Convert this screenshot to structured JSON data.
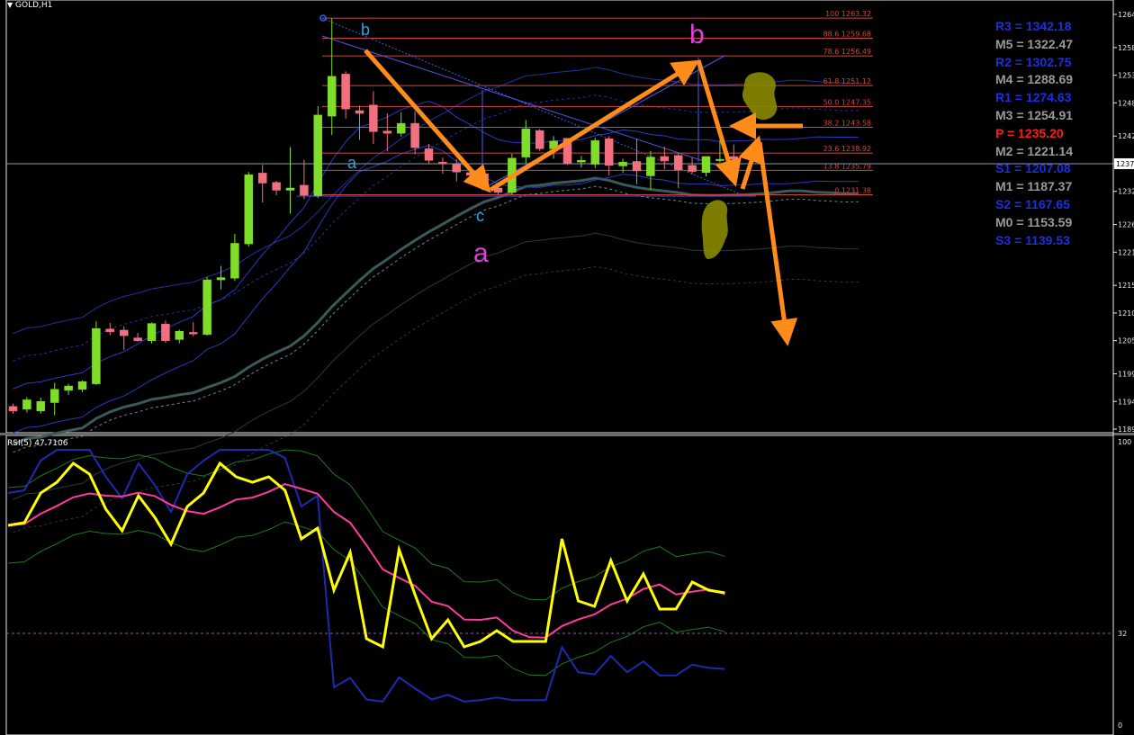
{
  "window": {
    "symbol_label": "GOLD,H1",
    "dropdown_icon": "triangle-down-icon"
  },
  "price_axis_ticks": [
    "1264",
    "1258",
    "1253",
    "1248",
    "1242",
    "1237",
    "1232",
    "1226",
    "1221",
    "1215",
    "1210",
    "1205",
    "1199",
    "1194",
    "1189"
  ],
  "current_price_tag": "1237",
  "fibonacci": {
    "levels": [
      {
        "label": "100 1263.32",
        "price": 1263.32
      },
      {
        "label": "88.6 1259.68",
        "price": 1259.68
      },
      {
        "label": "78.6 1256.49",
        "price": 1256.49
      },
      {
        "label": "61.8 1251.12",
        "price": 1251.12
      },
      {
        "label": "50.0 1247.35",
        "price": 1247.35
      },
      {
        "label": "38.2 1243.58",
        "price": 1243.58
      },
      {
        "label": "23.6 1238.92",
        "price": 1238.92
      },
      {
        "label": "13.8 1235.79",
        "price": 1235.79
      },
      {
        "label": "0 1231.38",
        "price": 1231.38
      }
    ],
    "color": "#d0463c"
  },
  "wave_labels": {
    "b_small": "b",
    "a_small": "a",
    "c_small": "c",
    "a_big": "a",
    "b_big": "b",
    "small_color": "#2aa8e6",
    "big_color": "#e040d8"
  },
  "pivots": [
    {
      "label": "R3",
      "value": "1342.18",
      "text": "R3 = 1342.18",
      "color": "#1a2fe0"
    },
    {
      "label": "M5",
      "value": "1322.47",
      "text": "M5 = 1322.47",
      "color": "#9a9a9a"
    },
    {
      "label": "R2",
      "value": "1302.75",
      "text": "R2 = 1302.75",
      "color": "#1a2fe0"
    },
    {
      "label": "M4",
      "value": "1288.69",
      "text": "M4 = 1288.69",
      "color": "#9a9a9a"
    },
    {
      "label": "R1",
      "value": "1274.63",
      "text": "R1 = 1274.63",
      "color": "#1a2fe0"
    },
    {
      "label": "M3",
      "value": "1254.91",
      "text": "M3 = 1254.91",
      "color": "#9a9a9a"
    },
    {
      "label": "P",
      "value": "1235.20",
      "text": "P  = 1235.20",
      "color": "#ff1a1a"
    },
    {
      "label": "M2",
      "value": "1221.14",
      "text": "M2 = 1221.14",
      "color": "#9a9a9a"
    },
    {
      "label": "S1",
      "value": "1207.08",
      "text": "S1 = 1207.08",
      "color": "#1a2fe0"
    },
    {
      "label": "M1",
      "value": "1187.37",
      "text": "M1 = 1187.37",
      "color": "#9a9a9a"
    },
    {
      "label": "S2",
      "value": "1167.65",
      "text": "S2 = 1167.65",
      "color": "#1a2fe0"
    },
    {
      "label": "M0",
      "value": "1153.59",
      "text": "M0 = 1153.59",
      "color": "#9a9a9a"
    },
    {
      "label": "S3",
      "value": "1139.53",
      "text": "S3 = 1139.53",
      "color": "#1a2fe0"
    }
  ],
  "rsi_panel": {
    "title": "RSI(5) 47.7106",
    "axis_ticks": [
      "100",
      "32",
      "0"
    ],
    "level_value": 32
  },
  "colors": {
    "bull_candle": "#7fdc2a",
    "bear_candle": "#f07080",
    "arrow": "#ff8c1a",
    "rsi_line": "#ffff00",
    "rsi_ma": "#ff3aa0",
    "stoch_line": "#1e2ab0",
    "band_line": "#1e7a1e",
    "highlight_blob": "#8a8a00"
  },
  "chart_data": [
    {
      "type": "candlestick",
      "title": "GOLD,H1",
      "y_axis_ticks": [
        1264,
        1258,
        1253,
        1248,
        1242,
        1237,
        1232,
        1226,
        1221,
        1215,
        1210,
        1205,
        1199,
        1194,
        1189
      ],
      "ylim": [
        1188,
        1265
      ],
      "candles": [
        {
          "o": 1193.1,
          "h": 1193.6,
          "l": 1191.8,
          "c": 1192.3
        },
        {
          "o": 1192.6,
          "h": 1194.8,
          "l": 1192.0,
          "c": 1194.3
        },
        {
          "o": 1192.3,
          "h": 1194.7,
          "l": 1191.8,
          "c": 1194.0
        },
        {
          "o": 1193.8,
          "h": 1197.4,
          "l": 1191.5,
          "c": 1196.2
        },
        {
          "o": 1196.0,
          "h": 1197.2,
          "l": 1195.2,
          "c": 1196.8
        },
        {
          "o": 1196.2,
          "h": 1197.8,
          "l": 1195.7,
          "c": 1197.6
        },
        {
          "o": 1197.2,
          "h": 1208.5,
          "l": 1197.0,
          "c": 1207.2
        },
        {
          "o": 1207.1,
          "h": 1208.2,
          "l": 1206.0,
          "c": 1206.6
        },
        {
          "o": 1206.9,
          "h": 1207.6,
          "l": 1203.3,
          "c": 1205.9
        },
        {
          "o": 1205.5,
          "h": 1206.4,
          "l": 1204.8,
          "c": 1205.0
        },
        {
          "o": 1205.0,
          "h": 1208.3,
          "l": 1204.5,
          "c": 1208.1
        },
        {
          "o": 1208.0,
          "h": 1208.6,
          "l": 1204.6,
          "c": 1205.0
        },
        {
          "o": 1205.2,
          "h": 1207.0,
          "l": 1204.5,
          "c": 1206.7
        },
        {
          "o": 1206.5,
          "h": 1208.3,
          "l": 1205.8,
          "c": 1206.2
        },
        {
          "o": 1206.1,
          "h": 1216.5,
          "l": 1205.9,
          "c": 1216.0
        },
        {
          "o": 1216.0,
          "h": 1218.5,
          "l": 1214.3,
          "c": 1216.4
        },
        {
          "o": 1216.3,
          "h": 1224.3,
          "l": 1215.8,
          "c": 1222.6
        },
        {
          "o": 1222.5,
          "h": 1235.5,
          "l": 1222.0,
          "c": 1235.0
        },
        {
          "o": 1235.3,
          "h": 1236.8,
          "l": 1230.0,
          "c": 1233.5
        },
        {
          "o": 1233.6,
          "h": 1233.9,
          "l": 1231.3,
          "c": 1232.2
        },
        {
          "o": 1232.2,
          "h": 1240.0,
          "l": 1228.0,
          "c": 1232.6
        },
        {
          "o": 1233.1,
          "h": 1237.7,
          "l": 1230.6,
          "c": 1231.3
        },
        {
          "o": 1231.2,
          "h": 1247.4,
          "l": 1230.8,
          "c": 1245.8
        },
        {
          "o": 1245.6,
          "h": 1263.3,
          "l": 1242.2,
          "c": 1252.8
        },
        {
          "o": 1253.2,
          "h": 1253.7,
          "l": 1245.2,
          "c": 1246.9
        },
        {
          "o": 1246.6,
          "h": 1247.5,
          "l": 1241.3,
          "c": 1246.1
        },
        {
          "o": 1247.6,
          "h": 1250.1,
          "l": 1240.6,
          "c": 1242.8
        },
        {
          "o": 1242.9,
          "h": 1246.1,
          "l": 1239.2,
          "c": 1242.5
        },
        {
          "o": 1242.5,
          "h": 1246.3,
          "l": 1241.9,
          "c": 1244.3
        },
        {
          "o": 1244.3,
          "h": 1246.5,
          "l": 1238.7,
          "c": 1239.9
        },
        {
          "o": 1239.7,
          "h": 1240.6,
          "l": 1237.1,
          "c": 1237.6
        },
        {
          "o": 1237.3,
          "h": 1238.1,
          "l": 1235.2,
          "c": 1237.0
        },
        {
          "o": 1236.9,
          "h": 1237.8,
          "l": 1233.8,
          "c": 1235.5
        },
        {
          "o": 1235.4,
          "h": 1236.5,
          "l": 1233.9,
          "c": 1234.9
        },
        {
          "o": 1235.2,
          "h": 1236.2,
          "l": 1232.3,
          "c": 1232.8
        },
        {
          "o": 1232.6,
          "h": 1233.4,
          "l": 1231.4,
          "c": 1231.8
        },
        {
          "o": 1231.8,
          "h": 1238.8,
          "l": 1231.4,
          "c": 1238.0
        },
        {
          "o": 1238.2,
          "h": 1244.9,
          "l": 1237.1,
          "c": 1243.3
        },
        {
          "o": 1243.0,
          "h": 1243.3,
          "l": 1239.3,
          "c": 1239.7
        },
        {
          "o": 1239.7,
          "h": 1242.0,
          "l": 1237.9,
          "c": 1241.1
        },
        {
          "o": 1241.6,
          "h": 1241.6,
          "l": 1236.8,
          "c": 1237.1
        },
        {
          "o": 1237.3,
          "h": 1238.4,
          "l": 1236.3,
          "c": 1237.6
        },
        {
          "o": 1236.9,
          "h": 1241.7,
          "l": 1236.2,
          "c": 1241.2
        },
        {
          "o": 1241.5,
          "h": 1242.0,
          "l": 1234.9,
          "c": 1236.7
        },
        {
          "o": 1236.6,
          "h": 1237.9,
          "l": 1235.4,
          "c": 1237.3
        },
        {
          "o": 1237.4,
          "h": 1241.5,
          "l": 1233.3,
          "c": 1235.7
        },
        {
          "o": 1234.8,
          "h": 1239.3,
          "l": 1232.3,
          "c": 1238.2
        },
        {
          "o": 1238.3,
          "h": 1240.1,
          "l": 1236.0,
          "c": 1237.5
        },
        {
          "o": 1238.5,
          "h": 1239.0,
          "l": 1232.6,
          "c": 1235.9
        },
        {
          "o": 1236.7,
          "h": 1238.1,
          "l": 1235.1,
          "c": 1235.6
        },
        {
          "o": 1235.4,
          "h": 1238.0,
          "l": 1234.7,
          "c": 1238.3
        },
        {
          "o": 1237.8,
          "h": 1241.2,
          "l": 1237.2,
          "c": 1237.8
        },
        {
          "o": 1238.3,
          "h": 1240.5,
          "l": 1237.8,
          "c": 1237.8
        }
      ],
      "fib_retracement": [
        1263.32,
        1259.68,
        1256.49,
        1251.12,
        1247.35,
        1243.58,
        1238.92,
        1235.79,
        1231.38
      ],
      "current_price": 1237
    },
    {
      "type": "line",
      "title": "RSI(5) 47.7106",
      "ylim": [
        0,
        100
      ],
      "y_axis_ticks": [
        100,
        32,
        0
      ],
      "series": [
        {
          "name": "RSI(5)",
          "values": [
            72,
            73,
            84,
            88,
            95,
            91,
            78,
            70,
            83,
            75,
            65,
            79,
            84,
            95,
            90,
            88,
            90,
            85,
            67,
            71,
            48,
            62,
            30,
            27,
            63,
            46,
            30,
            37,
            27,
            29,
            33,
            29,
            29,
            29,
            67,
            44,
            42,
            59,
            44,
            54,
            41,
            41,
            51,
            48,
            47
          ]
        }
      ]
    }
  ]
}
